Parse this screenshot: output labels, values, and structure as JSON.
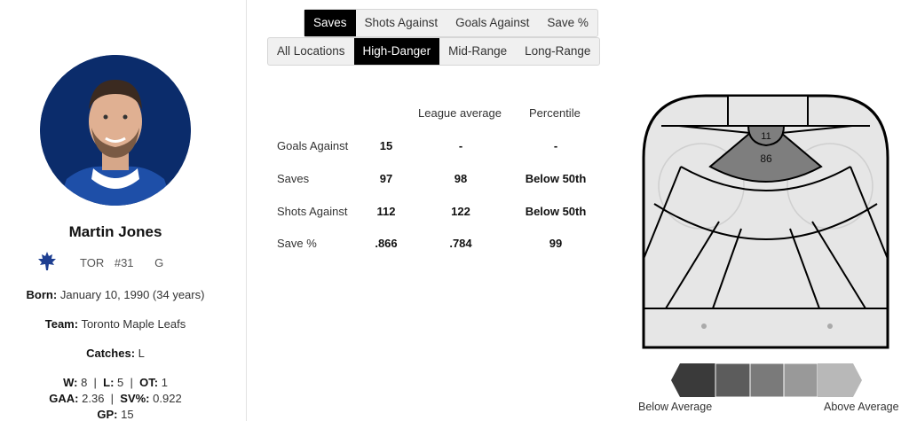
{
  "player": {
    "name": "Martin Jones",
    "team_abbr": "TOR",
    "number": "#31",
    "position": "G",
    "born_label": "Born:",
    "born_value": "January 10, 1990 (34 years)",
    "team_label": "Team:",
    "team_value": "Toronto Maple Leafs",
    "catches_label": "Catches:",
    "catches_value": "L",
    "record": {
      "w_label": "W:",
      "w_value": "8",
      "l_label": "L:",
      "l_value": "5",
      "ot_label": "OT:",
      "ot_value": "1"
    },
    "gaa_label": "GAA:",
    "gaa_value": "2.36",
    "svpct_label": "SV%:",
    "svpct_value": "0.922",
    "gp_label": "GP:",
    "gp_value": "15"
  },
  "metric_tabs": [
    {
      "label": "Saves",
      "active": true
    },
    {
      "label": "Shots Against",
      "active": false
    },
    {
      "label": "Goals Against",
      "active": false
    },
    {
      "label": "Save %",
      "active": false
    }
  ],
  "location_tabs": [
    {
      "label": "All Locations",
      "active": false
    },
    {
      "label": "High-Danger",
      "active": true
    },
    {
      "label": "Mid-Range",
      "active": false
    },
    {
      "label": "Long-Range",
      "active": false
    }
  ],
  "stats": {
    "headers": {
      "league": "League average",
      "percentile": "Percentile"
    },
    "rows": [
      {
        "label": "Goals Against",
        "value": "15",
        "league": "-",
        "percentile": "-"
      },
      {
        "label": "Saves",
        "value": "97",
        "league": "98",
        "percentile": "Below 50th"
      },
      {
        "label": "Shots Against",
        "value": "112",
        "league": "122",
        "percentile": "Below 50th"
      },
      {
        "label": "Save %",
        "value": ".866",
        "league": ".784",
        "percentile": "99"
      }
    ]
  },
  "rink": {
    "crease_value": "11",
    "slot_value": "86"
  },
  "legend": {
    "low_label": "Below Average",
    "high_label": "Above Average",
    "colors": [
      "#3a3a3a",
      "#5c5c5c",
      "#7a7a7a",
      "#999999",
      "#b8b8b8"
    ]
  }
}
